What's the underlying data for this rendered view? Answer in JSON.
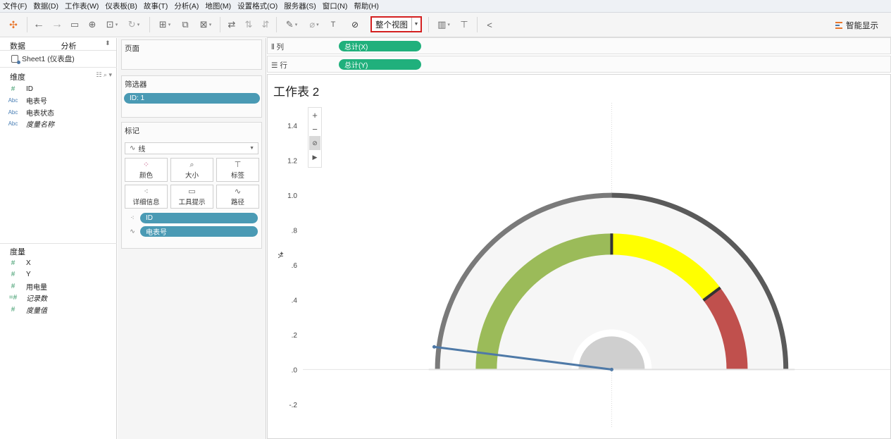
{
  "menubar": [
    "文件(F)",
    "数据(D)",
    "工作表(W)",
    "仪表板(B)",
    "故事(T)",
    "分析(A)",
    "地图(M)",
    "设置格式(O)",
    "服务器(S)",
    "窗口(N)",
    "帮助(H)"
  ],
  "toolbar": {
    "fit_view": "整个视图",
    "show_me": "智能显示"
  },
  "datapane": {
    "tabs": [
      "数据",
      "分析"
    ],
    "source": "Sheet1 (仪表盘)",
    "dimensions_header": "维度",
    "dimensions": [
      {
        "icon": "#",
        "name": "ID",
        "italic": false
      },
      {
        "icon": "Abc",
        "name": "电表号",
        "italic": false
      },
      {
        "icon": "Abc",
        "name": "电表状态",
        "italic": false
      },
      {
        "icon": "Abc",
        "name": "度量名称",
        "italic": true
      }
    ],
    "measures_header": "度量",
    "measures": [
      {
        "icon": "#",
        "name": "X",
        "italic": false
      },
      {
        "icon": "#",
        "name": "Y",
        "italic": false
      },
      {
        "icon": "#",
        "name": "用电量",
        "italic": false
      },
      {
        "icon": "=#",
        "name": "记录数",
        "italic": true
      },
      {
        "icon": "#",
        "name": "度量值",
        "italic": true
      }
    ]
  },
  "cards": {
    "pages": "页面",
    "filters": "筛选器",
    "filter_pill": "ID: 1",
    "marks": "标记",
    "mark_type": "线",
    "mark_buttons": [
      "颜色",
      "大小",
      "标签",
      "详细信息",
      "工具提示",
      "路径"
    ],
    "mark_fields": [
      "ID",
      "电表号"
    ]
  },
  "shelves": {
    "columns_label": "列",
    "columns_pill": "总计(X)",
    "rows_label": "行",
    "rows_pill": "总计(Y)"
  },
  "view": {
    "title": "工作表 2",
    "y_axis_label": "Y"
  },
  "chart_data": {
    "type": "line",
    "ylabel": "Y",
    "yticks": [
      "1.4",
      "1.2",
      "1.0",
      ".8",
      ".6",
      ".4",
      ".2",
      ".0",
      "-.2"
    ],
    "ylim": [
      -0.33,
      1.53
    ],
    "xlim": [
      -1.74,
      1.57
    ],
    "gauge": {
      "outer_ring_color": "#5a5a5a",
      "bands": [
        {
          "from_deg": 180,
          "to_deg": 90,
          "color": "#9bbb59"
        },
        {
          "from_deg": 90,
          "to_deg": 37,
          "color": "#ffff00"
        },
        {
          "from_deg": 37,
          "to_deg": 0,
          "color": "#c0504d"
        }
      ]
    },
    "series": [
      {
        "x": [
          0,
          -1.0
        ],
        "y": [
          0,
          0.13
        ],
        "color": "#4e79a7"
      }
    ]
  }
}
